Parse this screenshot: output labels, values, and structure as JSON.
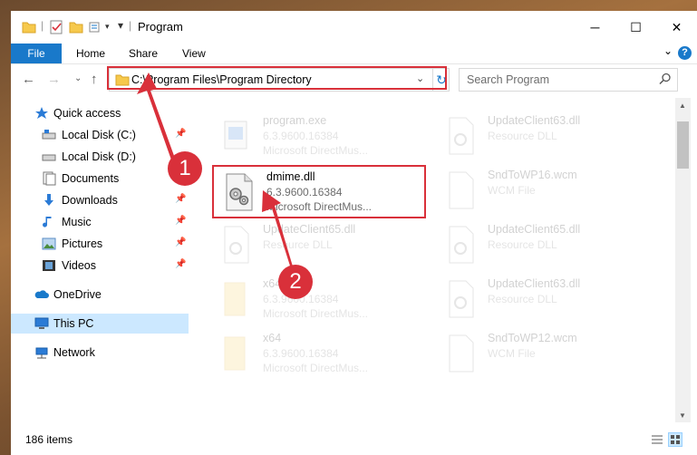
{
  "window": {
    "title": "Program",
    "controls": {
      "minimize": "─",
      "maximize": "☐",
      "close": "✕"
    }
  },
  "ribbon": {
    "tabs": [
      "File",
      "Home",
      "Share",
      "View"
    ],
    "expand": "⌄",
    "help": "?"
  },
  "address": {
    "path": "C:\\Program Files\\Program Directory",
    "dropdown": "⌄",
    "refresh": "↻"
  },
  "search": {
    "placeholder": "Search Program"
  },
  "sidebar": {
    "items": [
      {
        "label": "Quick access",
        "icon": "star-icon",
        "pinned": false,
        "selected": false
      },
      {
        "label": "Local Disk (C:)",
        "icon": "drive-icon",
        "pinned": true,
        "selected": false
      },
      {
        "label": "Local Disk (D:)",
        "icon": "drive-icon",
        "pinned": false,
        "selected": false
      },
      {
        "label": "Documents",
        "icon": "documents-icon",
        "pinned": true,
        "selected": false
      },
      {
        "label": "Downloads",
        "icon": "downloads-icon",
        "pinned": true,
        "selected": false
      },
      {
        "label": "Music",
        "icon": "music-icon",
        "pinned": true,
        "selected": false
      },
      {
        "label": "Pictures",
        "icon": "pictures-icon",
        "pinned": true,
        "selected": false
      },
      {
        "label": "Videos",
        "icon": "videos-icon",
        "pinned": true,
        "selected": false
      },
      {
        "label": "OneDrive",
        "icon": "onedrive-icon",
        "pinned": false,
        "selected": false
      },
      {
        "label": "This PC",
        "icon": "pc-icon",
        "pinned": false,
        "selected": true
      },
      {
        "label": "Network",
        "icon": "network-icon",
        "pinned": false,
        "selected": false
      }
    ]
  },
  "files": [
    {
      "name": "program.exe",
      "line2": "6.3.9600.16384",
      "line3": "Microsoft DirectMus...",
      "icon": "exe-icon",
      "faded": true
    },
    {
      "name": "UpdateClient63.dll",
      "line2": "Resource DLL",
      "line3": "",
      "icon": "dll-icon",
      "faded": true
    },
    {
      "name": "dmime.dll",
      "line2": "6.3.9600.16384",
      "line3": "Microsoft DirectMus...",
      "icon": "dll-gear-icon",
      "faded": false
    },
    {
      "name": "SndToWP16.wcm",
      "line2": "WCM File",
      "line3": "",
      "icon": "file-icon",
      "faded": true
    },
    {
      "name": "UpdateClient65.dll",
      "line2": "Resource DLL",
      "line3": "",
      "icon": "dll-icon",
      "faded": true
    },
    {
      "name": "UpdateClient65.dll",
      "line2": "Resource DLL",
      "line3": "",
      "icon": "dll-icon",
      "faded": true
    },
    {
      "name": "x64",
      "line2": "6.3.9600.16384",
      "line3": "Microsoft DirectMus...",
      "icon": "folder-file-icon",
      "faded": true
    },
    {
      "name": "UpdateClient63.dll",
      "line2": "Resource DLL",
      "line3": "",
      "icon": "dll-icon",
      "faded": true
    },
    {
      "name": "x64",
      "line2": "6.3.9600.16384",
      "line3": "Microsoft DirectMus...",
      "icon": "folder-file-icon",
      "faded": true
    },
    {
      "name": "SndToWP12.wcm",
      "line2": "WCM File",
      "line3": "",
      "icon": "file-icon",
      "faded": true
    }
  ],
  "status": {
    "item_count": "186 items"
  },
  "annotations": [
    {
      "number": "1",
      "color": "#d9303a"
    },
    {
      "number": "2",
      "color": "#d9303a"
    }
  ],
  "colors": {
    "accent": "#1979ca",
    "highlight": "#d9303a",
    "selection": "#cce8ff"
  }
}
